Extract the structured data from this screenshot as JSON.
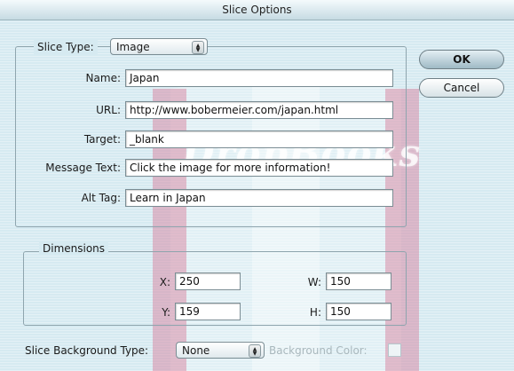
{
  "window": {
    "title": "Slice Options"
  },
  "watermark": {
    "text": "DropBooks"
  },
  "slice_type": {
    "label": "Slice Type:",
    "value": "Image"
  },
  "fields": {
    "name": {
      "label": "Name:",
      "value": "Japan"
    },
    "url": {
      "label": "URL:",
      "value": "http://www.bobermeier.com/japan.html"
    },
    "target": {
      "label": "Target:",
      "value": "_blank"
    },
    "message": {
      "label": "Message Text:",
      "value": "Click the image for more information!"
    },
    "alt": {
      "label": "Alt Tag:",
      "value": "Learn in Japan"
    }
  },
  "dimensions": {
    "legend": "Dimensions",
    "x": {
      "label": "X:",
      "value": "250"
    },
    "y": {
      "label": "Y:",
      "value": "159"
    },
    "w": {
      "label": "W:",
      "value": "150"
    },
    "h": {
      "label": "H:",
      "value": "150"
    }
  },
  "background": {
    "label": "Slice Background Type:",
    "value": "None",
    "color_label": "Background Color:"
  },
  "buttons": {
    "ok": "OK",
    "cancel": "Cancel"
  }
}
